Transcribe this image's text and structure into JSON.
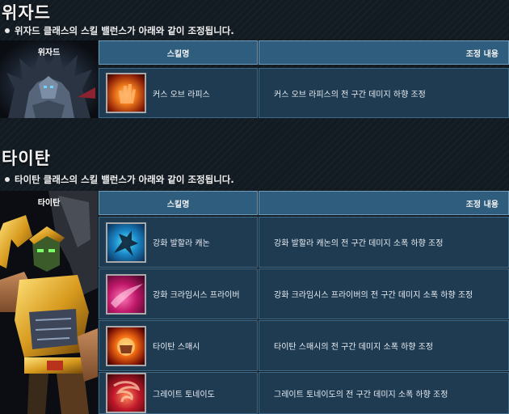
{
  "wizard": {
    "title": "위자드",
    "description": "위자드 클래스의 스킬 밸런스가 아래와 같이 조정됩니다.",
    "character_label": "위자드",
    "header_skill": "스킬명",
    "header_change": "조정 내용",
    "skills": [
      {
        "name": "커스 오브 라피스",
        "change": "커스 오브 라피스의 전 구간 데미지 하향 조정",
        "icon": "curse-of-lapis-icon"
      }
    ]
  },
  "titan": {
    "title": "타이탄",
    "description": "타이탄 클래스의 스킬 밸런스가 아래와 같이 조정됩니다.",
    "character_label": "타이탄",
    "header_skill": "스킬명",
    "header_change": "조정 내용",
    "skills": [
      {
        "name": "강화 발할라 캐논",
        "change": "강화 발할라 캐논의 전 구간 데미지 소폭 하향 조정",
        "icon": "valhalla-cannon-icon"
      },
      {
        "name": "강화 크라임시스 프라이버",
        "change": "강화 크라임시스 프라이버의 전 구간 데미지 소폭 하향 조정",
        "icon": "crimesis-driver-icon"
      },
      {
        "name": "타이탄 스매시",
        "change": "타이탄 스매시의 전 구간 데미지 소폭 하향 조정",
        "icon": "titan-smash-icon"
      },
      {
        "name": "그레이트 토네이도",
        "change": "그레이트 토네이도의 전 구간 데미지 소폭 하향 조정",
        "icon": "great-tornado-icon"
      }
    ]
  },
  "colors": {
    "header_bg": "#2f5d7e",
    "row_bg": "#1f3b52",
    "page_bg": "#121a22"
  }
}
